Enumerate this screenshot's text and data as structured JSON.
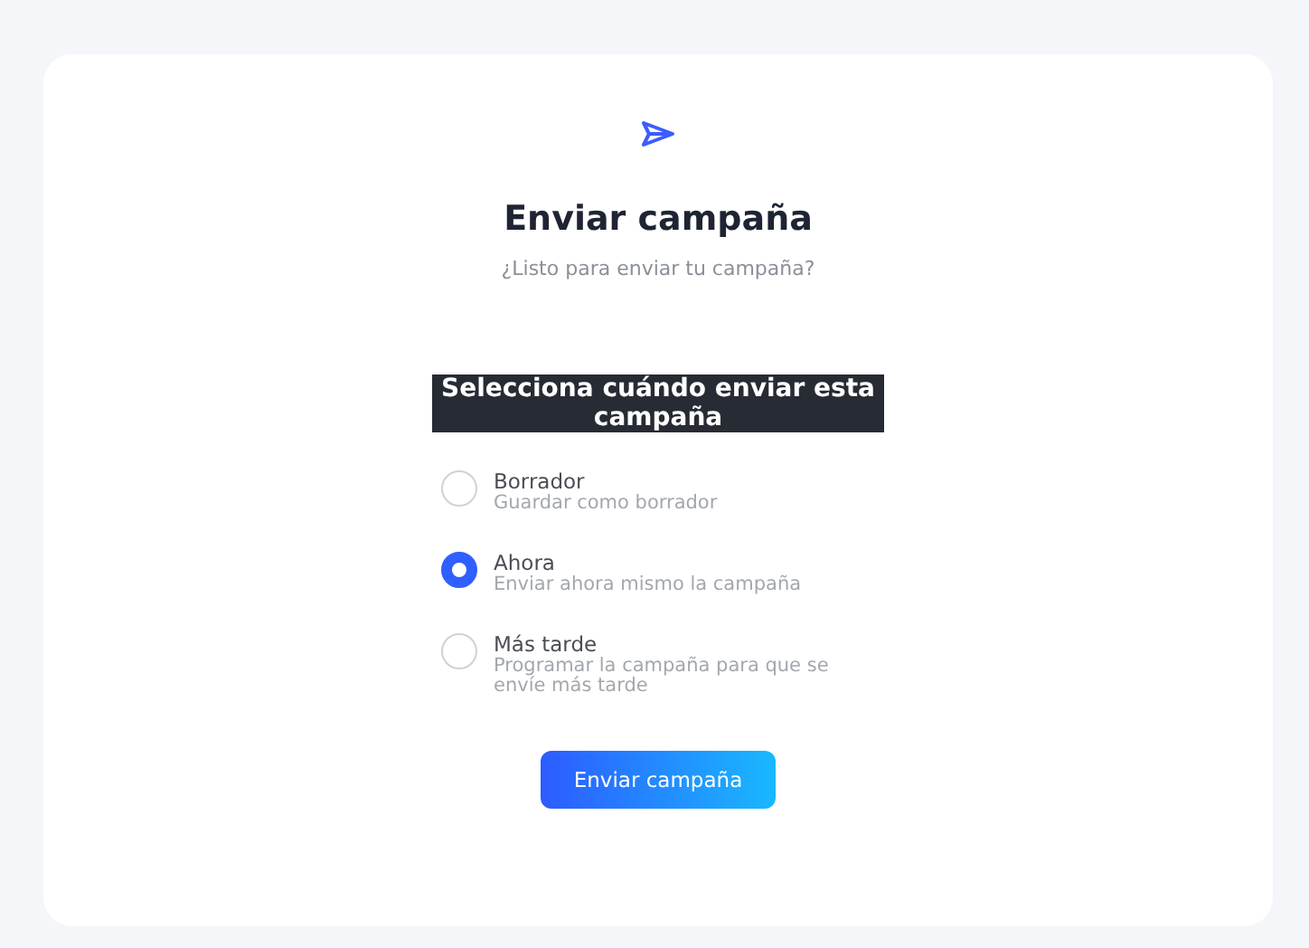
{
  "dialog": {
    "title": "Enviar campaña",
    "subtitle": "¿Listo para enviar tu campaña?"
  },
  "schedule": {
    "heading": "Selecciona cuándo enviar esta campaña",
    "options": [
      {
        "label": "Borrador",
        "description": "Guardar como borrador",
        "selected": false
      },
      {
        "label": "Ahora",
        "description": "Enviar ahora mismo la campaña",
        "selected": true
      },
      {
        "label": "Más tarde",
        "description": "Programar la campaña para que se envíe más tarde",
        "selected": false
      }
    ]
  },
  "button": "Enviar campaña"
}
